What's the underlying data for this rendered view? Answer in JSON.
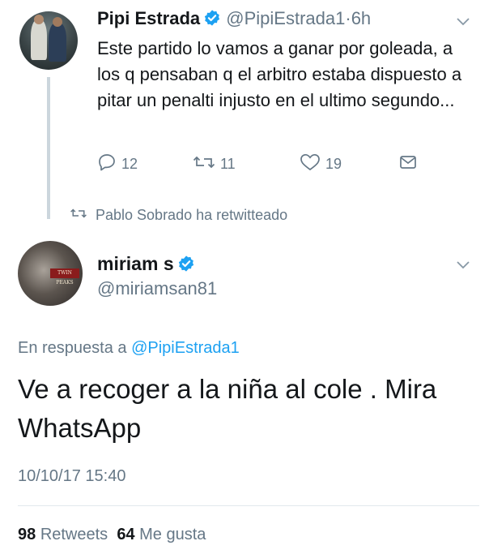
{
  "tweet1": {
    "name": "Pipi Estrada",
    "handle": "@PipiEstrada1",
    "separator": "·",
    "time": "6h",
    "text": "Este partido lo vamos a ganar por goleada, a los q pensaban q el arbitro estaba dispuesto a pitar un penalti injusto en el ultimo segundo...",
    "replies": "12",
    "retweets": "11",
    "likes": "19"
  },
  "retweet_context": {
    "text": "Pablo Sobrado ha retwitteado"
  },
  "tweet2": {
    "name": "miriam s",
    "handle": "@miriamsan81",
    "avatar_banner": "TWIN PEAKS",
    "reply_prefix": "En respuesta a",
    "reply_handle": "@PipiEstrada1",
    "text": "Ve a recoger a la niña al cole . Mira WhatsApp",
    "timestamp": "10/10/17 15:40",
    "retweets_count": "98",
    "retweets_label": "Retweets",
    "likes_count": "64",
    "likes_label": "Me gusta"
  },
  "colors": {
    "link": "#1da1f2",
    "secondary_text": "#657786",
    "verified": "#1da1f2"
  }
}
